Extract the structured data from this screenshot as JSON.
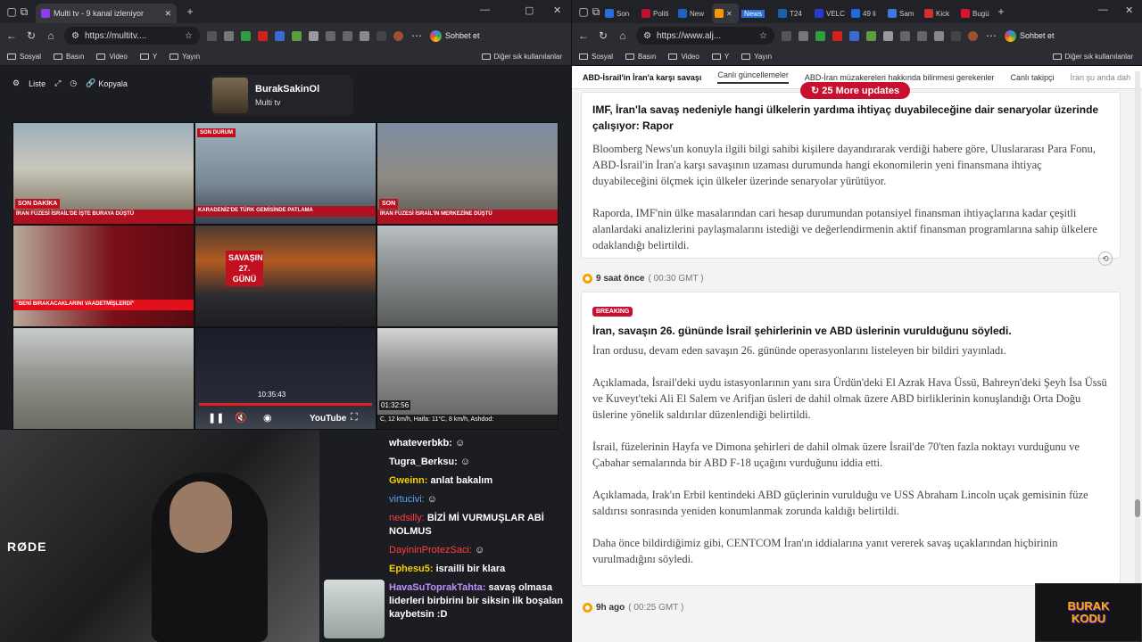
{
  "left_window": {
    "tab_title": "Multi tv - 9 kanal izleniyor",
    "url": "https://multitv....",
    "chat_button": "Sohbet et",
    "bookmarks": [
      "Sosyal",
      "Basın",
      "Video",
      "Y",
      "Yayın"
    ],
    "bookmarks_right": "Diğer sık kullanılanlar"
  },
  "multitv": {
    "toolbar": {
      "list": "Liste",
      "copy": "Kopyala"
    },
    "channel": {
      "name": "BurakSakinOl",
      "sub": "Multi tv"
    },
    "cells": [
      {
        "chip": "SON DAKİKA",
        "overlay": "İRAN FÜZESİ İSRAİL'DE İŞTE BURAYA DÜŞTÜ"
      },
      {
        "chip": "SON DURUM",
        "overlay": "KARADENİZ'DE TÜRK GEMİSİNDE PATLAMA"
      },
      {
        "chip": "SON",
        "overlay": "İRAN FÜZESİ İSRAİL'İN MERKEZİNE DÜŞTÜ"
      },
      {
        "chip": "",
        "overlay": "\"BENİ BIRAKACAKLARINI VAADETMİŞLERDİ\""
      },
      {
        "chip": "SAVAŞIN 27. GÜNÜ",
        "overlay": ""
      },
      {
        "chip": "",
        "overlay": ""
      },
      {
        "chip": "",
        "overlay": ""
      },
      {
        "chip": "10:35:43",
        "overlay": "YouTube"
      },
      {
        "chip": "01:32:56",
        "overlay": "C, 12 km/h, Haifa: 11°C, 8 km/h, Ashdod:"
      }
    ]
  },
  "chat": [
    {
      "user": "whateverbkb:",
      "text": "",
      "color": "#ffffff"
    },
    {
      "user": "Tugra_Berksu:",
      "text": "",
      "color": "#ffffff"
    },
    {
      "user": "Gweinn:",
      "text": "anlat bakalım",
      "color": "#f5d000"
    },
    {
      "user": "virtucivi:",
      "text": "",
      "color": "#5aa0ff"
    },
    {
      "user": "nedsilly:",
      "text": "BİZİ Mİ VURMUŞLAR ABİ NOLMUS",
      "color": "#ff4040"
    },
    {
      "user": "DayininProtezSaci:",
      "text": "",
      "color": "#ff4040"
    },
    {
      "user": "Ephesu5:",
      "text": "israilli bir klara",
      "color": "#f5d000"
    },
    {
      "user": "HavaSuToprakTahta:",
      "text": "savaş olmasa liderleri birbirini bir siksin ilk boşalan kaybetsin :D",
      "color": "#c090ff"
    }
  ],
  "webcam": {
    "mic": "RØDE"
  },
  "right_window": {
    "url": "https://www.alj...",
    "tabs": [
      "Son",
      "Politi",
      "New",
      "",
      "News",
      "T24",
      "VELC",
      "49 li",
      "Sam",
      "Kick",
      "Bugü"
    ],
    "chat_button": "Sohbet et",
    "bookmarks": [
      "Sosyal",
      "Basın",
      "Video",
      "Y",
      "Yayın"
    ],
    "bookmarks_right": "Diğer sık kullanılanlar",
    "nav": [
      "ABD-İsrail'in İran'a karşı savaşı",
      "Canlı güncellemeler",
      "ABD-İran müzakereleri hakkında bilinmesi gerekenler",
      "Canlı takipçi",
      "İran şu anda dah"
    ],
    "updates_pill": "25 More updates",
    "card1": {
      "title": "IMF, İran'la savaş nedeniyle hangi ülkelerin yardıma ihtiyaç duyabileceğine dair senaryolar üzerinde çalışıyor: Rapor",
      "p": [
        "Bloomberg News'un konuyla ilgili bilgi sahibi kişilere dayandırarak verdiği habere göre, Uluslararası Para Fonu, ABD-İsrail'in İran'a karşı savaşının uzaması durumunda hangi ekonomilerin yeni finansmana ihtiyaç duyabileceğini ölçmek için ülkeler üzerinde senaryolar yürütüyor.",
        "Raporda, IMF'nin ülke masalarından cari hesap durumundan potansiyel finansman ihtiyaçlarına kadar çeşitli alanlardaki analizlerini paylaşmalarını istediği ve değerlendirmenin aktif finansman programlarına sahip ülkelere odaklandığı belirtildi."
      ]
    },
    "time1": {
      "rel": "9 saat önce",
      "gmt": "( 00:30 GMT )"
    },
    "card2": {
      "badge": "BREAKING",
      "title": "İran, savaşın 26. gününde İsrail şehirlerinin ve ABD üslerinin vurulduğunu söyledi.",
      "p": [
        "İran ordusu, devam eden savaşın 26. gününde operasyonlarını listeleyen bir bildiri yayınladı.",
        "Açıklamada, İsrail'deki uydu istasyonlarının yanı sıra Ürdün'deki El Azrak Hava Üssü, Bahreyn'deki Şeyh İsa Üssü ve Kuveyt'teki Ali El Salem ve Arifjan üsleri de dahil olmak üzere ABD birliklerinin konuşlandığı Orta Doğu üslerine yönelik saldırılar düzenlendiği belirtildi.",
        "İsrail, füzelerinin Hayfa ve Dimona şehirleri de dahil olmak üzere İsrail'de 70'ten fazla noktayı vurduğunu ve Çabahar semalarında bir ABD F-18 uçağını vurduğunu iddia etti.",
        "Açıklamada, Irak'ın Erbil kentindeki ABD güçlerinin vurulduğu ve USS Abraham Lincoln uçak gemisinin füze saldırısı sonrasında yeniden konumlanmak zorunda kaldığı belirtildi.",
        "Daha önce bildirdiğimiz gibi, CENTCOM İran'ın iddialarına yanıt vererek savaş uçaklarından hiçbirinin vurulmadığını söyledi."
      ]
    },
    "time2": {
      "rel": "9h ago",
      "gmt": "( 00:25 GMT )"
    }
  },
  "logo": {
    "line1": "BURAK",
    "line2": "KODU"
  }
}
